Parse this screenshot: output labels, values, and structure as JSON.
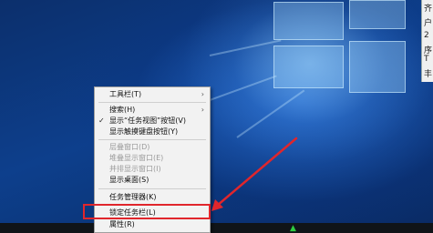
{
  "menu": {
    "items": [
      {
        "label": "工具栏(T)",
        "submenu": true
      },
      {
        "label": "搜索(H)",
        "submenu": true
      },
      {
        "label": "显示“任务视图”按钮(V)",
        "checked": true
      },
      {
        "label": "显示触摸键盘按钮(Y)"
      },
      {
        "label": "层叠窗口(D)",
        "disabled": true
      },
      {
        "label": "堆叠显示窗口(E)",
        "disabled": true
      },
      {
        "label": "并排显示窗口(I)",
        "disabled": true
      },
      {
        "label": "显示桌面(S)"
      },
      {
        "label": "任务管理器(K)"
      },
      {
        "label": "锁定任务栏(L)"
      },
      {
        "label": "属性(R)"
      }
    ],
    "submenu_glyph": "›",
    "check_glyph": "✓"
  },
  "edge_window": {
    "glyphs": [
      "齐",
      "户",
      "2",
      "序",
      "T",
      "丰"
    ]
  },
  "colors": {
    "highlight": "#e0262c",
    "menu_bg": "#f2f2f2"
  }
}
